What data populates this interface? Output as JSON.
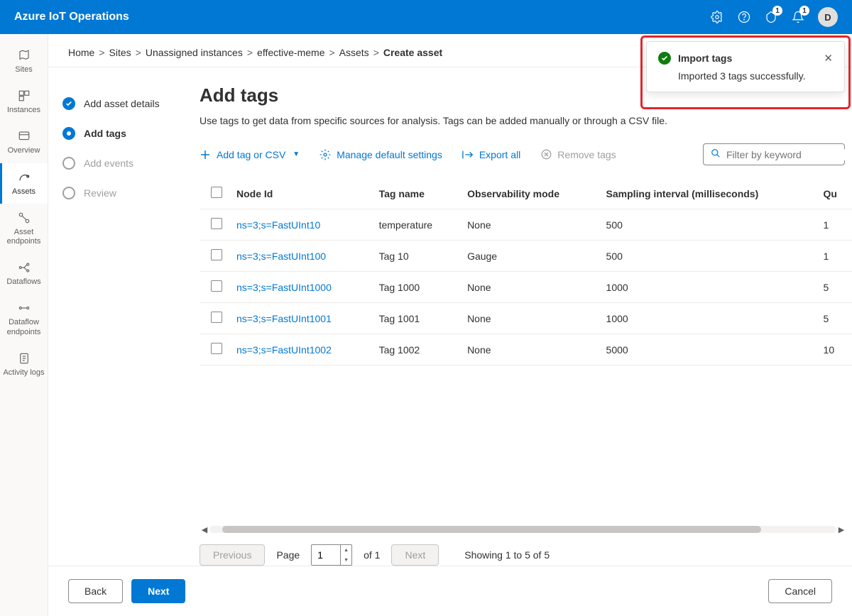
{
  "topbar": {
    "title": "Azure IoT Operations",
    "notification_badge1": "1",
    "notification_badge2": "1",
    "avatar_initial": "D"
  },
  "leftnav": [
    {
      "label": "Sites",
      "icon": "map"
    },
    {
      "label": "Instances",
      "icon": "instances"
    },
    {
      "label": "Overview",
      "icon": "overview"
    },
    {
      "label": "Assets",
      "icon": "assets",
      "active": true
    },
    {
      "label": "Asset endpoints",
      "icon": "endpoint"
    },
    {
      "label": "Dataflows",
      "icon": "flow"
    },
    {
      "label": "Dataflow endpoints",
      "icon": "flowend"
    },
    {
      "label": "Activity logs",
      "icon": "logs"
    }
  ],
  "breadcrumb": [
    "Home",
    "Sites",
    "Unassigned instances",
    "effective-meme",
    "Assets",
    "Create asset"
  ],
  "steps": [
    {
      "label": "Add asset details",
      "state": "completed"
    },
    {
      "label": "Add tags",
      "state": "current"
    },
    {
      "label": "Add events",
      "state": "pending"
    },
    {
      "label": "Review",
      "state": "pending"
    }
  ],
  "page": {
    "title": "Add tags",
    "description": "Use tags to get data from specific sources for analysis. Tags can be added manually or through a CSV file."
  },
  "toolbar": {
    "add_label": "Add tag or CSV",
    "manage_label": "Manage default settings",
    "export_label": "Export all",
    "remove_label": "Remove tags",
    "filter_placeholder": "Filter by keyword"
  },
  "table": {
    "headers": [
      "Node Id",
      "Tag name",
      "Observability mode",
      "Sampling interval (milliseconds)",
      "Qu"
    ],
    "rows": [
      {
        "node_id": "ns=3;s=FastUInt10",
        "tag_name": "temperature",
        "mode": "None",
        "interval": "500",
        "q": "1"
      },
      {
        "node_id": "ns=3;s=FastUInt100",
        "tag_name": "Tag 10",
        "mode": "Gauge",
        "interval": "500",
        "q": "1"
      },
      {
        "node_id": "ns=3;s=FastUInt1000",
        "tag_name": "Tag 1000",
        "mode": "None",
        "interval": "1000",
        "q": "5"
      },
      {
        "node_id": "ns=3;s=FastUInt1001",
        "tag_name": "Tag 1001",
        "mode": "None",
        "interval": "1000",
        "q": "5"
      },
      {
        "node_id": "ns=3;s=FastUInt1002",
        "tag_name": "Tag 1002",
        "mode": "None",
        "interval": "5000",
        "q": "10"
      }
    ]
  },
  "pagination": {
    "prev": "Previous",
    "next": "Next",
    "page_label": "Page",
    "page_value": "1",
    "of_label": "of 1",
    "showing": "Showing 1 to 5 of 5"
  },
  "footer": {
    "back": "Back",
    "next": "Next",
    "cancel": "Cancel"
  },
  "toast": {
    "title": "Import tags",
    "message": "Imported 3 tags successfully."
  }
}
